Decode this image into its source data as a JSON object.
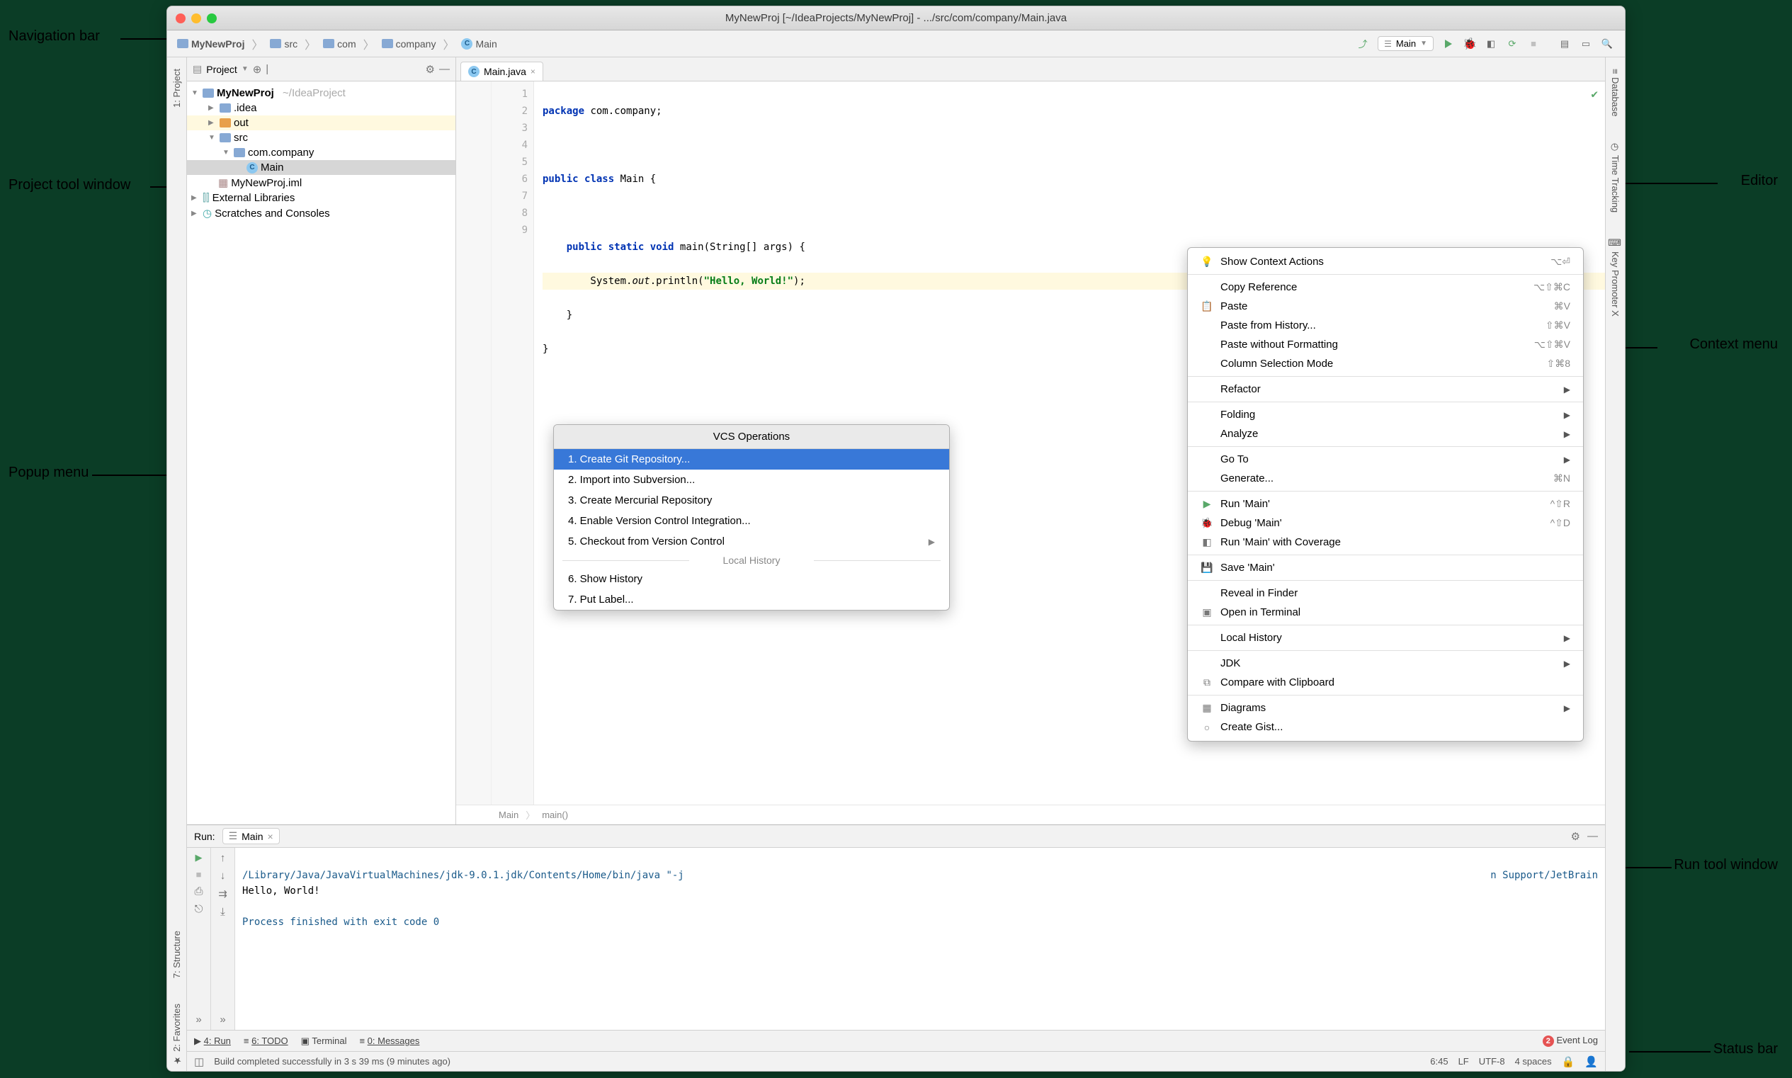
{
  "window": {
    "title": "MyNewProj [~/IdeaProjects/MyNewProj] - .../src/com/company/Main.java"
  },
  "annotations": {
    "nav": "Navigation bar",
    "project_tool": "Project tool window",
    "popup": "Popup menu",
    "editor": "Editor",
    "context": "Context menu",
    "run_tool": "Run tool window",
    "status": "Status bar"
  },
  "breadcrumb": {
    "root": "MyNewProj",
    "items": [
      "src",
      "com",
      "company",
      "Main"
    ]
  },
  "toolbar": {
    "run_config": "Main"
  },
  "project_panel": {
    "header": "Project",
    "root": "MyNewProj",
    "root_path": "~/IdeaProject",
    "nodes": {
      "idea": ".idea",
      "out": "out",
      "src": "src",
      "pkg": "com.company",
      "main": "Main",
      "iml": "MyNewProj.iml",
      "ext": "External Libraries",
      "scratch": "Scratches and Consoles"
    }
  },
  "editor": {
    "tab": "Main.java",
    "lines": {
      "l1_kw": "package",
      "l1_rest": " com.company;",
      "l3_kw1": "public",
      "l3_kw2": "class",
      "l3_rest": " Main {",
      "l5_kw1": "public",
      "l5_kw2": "static",
      "l5_kw3": "void",
      "l5_rest": " main(String[] args) {",
      "l6_pre": "        System.",
      "l6_out": "out",
      "l6_mid": ".println(",
      "l6_str": "\"Hello, World!\"",
      "l6_post": ");",
      "l7": "    }",
      "l8": "}"
    },
    "gutter_nums": [
      "1",
      "2",
      "3",
      "4",
      "5",
      "6",
      "7",
      "8",
      "9"
    ],
    "crumb1": "Main",
    "crumb2": "main()"
  },
  "vcs_popup": {
    "title": "VCS Operations",
    "items": [
      "1. Create Git Repository...",
      "2. Import into Subversion...",
      "3. Create Mercurial Repository",
      "4. Enable Version Control Integration...",
      "5. Checkout from Version Control"
    ],
    "sep": "Local History",
    "items2": [
      "6. Show History",
      "7. Put Label..."
    ]
  },
  "context_menu": {
    "items": [
      {
        "label": "Show Context Actions",
        "short": "⌥⏎",
        "icon": "💡"
      },
      {
        "divider": true
      },
      {
        "label": "Copy Reference",
        "short": "⌥⇧⌘C"
      },
      {
        "label": "Paste",
        "short": "⌘V",
        "icon": "📋"
      },
      {
        "label": "Paste from History...",
        "short": "⇧⌘V"
      },
      {
        "label": "Paste without Formatting",
        "short": "⌥⇧⌘V"
      },
      {
        "label": "Column Selection Mode",
        "short": "⇧⌘8"
      },
      {
        "divider": true
      },
      {
        "label": "Refactor",
        "submenu": true
      },
      {
        "divider": true
      },
      {
        "label": "Folding",
        "submenu": true
      },
      {
        "label": "Analyze",
        "submenu": true
      },
      {
        "divider": true
      },
      {
        "label": "Go To",
        "submenu": true
      },
      {
        "label": "Generate...",
        "short": "⌘N"
      },
      {
        "divider": true
      },
      {
        "label": "Run 'Main'",
        "short": "^⇧R",
        "icon": "▶",
        "iconcolor": "#59a869"
      },
      {
        "label": "Debug 'Main'",
        "short": "^⇧D",
        "icon": "🐞",
        "iconcolor": "#e08a3c"
      },
      {
        "label": "Run 'Main' with Coverage",
        "icon": "◧"
      },
      {
        "divider": true
      },
      {
        "label": "Save 'Main'",
        "icon": "💾"
      },
      {
        "divider": true
      },
      {
        "label": "Reveal in Finder"
      },
      {
        "label": "Open in Terminal",
        "icon": "▣"
      },
      {
        "divider": true
      },
      {
        "label": "Local History",
        "submenu": true
      },
      {
        "divider": true
      },
      {
        "label": "JDK",
        "submenu": true
      },
      {
        "label": "Compare with Clipboard",
        "icon": "⧉"
      },
      {
        "divider": true
      },
      {
        "label": "Diagrams",
        "submenu": true,
        "icon": "▦"
      },
      {
        "label": "Create Gist...",
        "icon": "○"
      }
    ]
  },
  "run_panel": {
    "title": "Run:",
    "tab": "Main",
    "output_path": "/Library/Java/JavaVirtualMachines/jdk-9.0.1.jdk/Contents/Home/bin/java \"-j",
    "output_path_tail": "n Support/JetBrain",
    "hello": "Hello, World!",
    "exit": "Process finished with exit code 0"
  },
  "bottom_tabs": {
    "run": "4: Run",
    "todo": "6: TODO",
    "terminal": "Terminal",
    "messages": "0: Messages",
    "event_log": "Event Log",
    "event_count": "2"
  },
  "status": {
    "msg": "Build completed successfully in 3 s 39 ms (9 minutes ago)",
    "pos": "6:45",
    "line_end": "LF",
    "encoding": "UTF-8",
    "indent": "4 spaces"
  },
  "side_tabs": {
    "project": "1: Project",
    "structure": "7: Structure",
    "favorites": "2: Favorites",
    "database": "Database",
    "time": "Time Tracking",
    "keypromoter": "Key Promoter X"
  }
}
